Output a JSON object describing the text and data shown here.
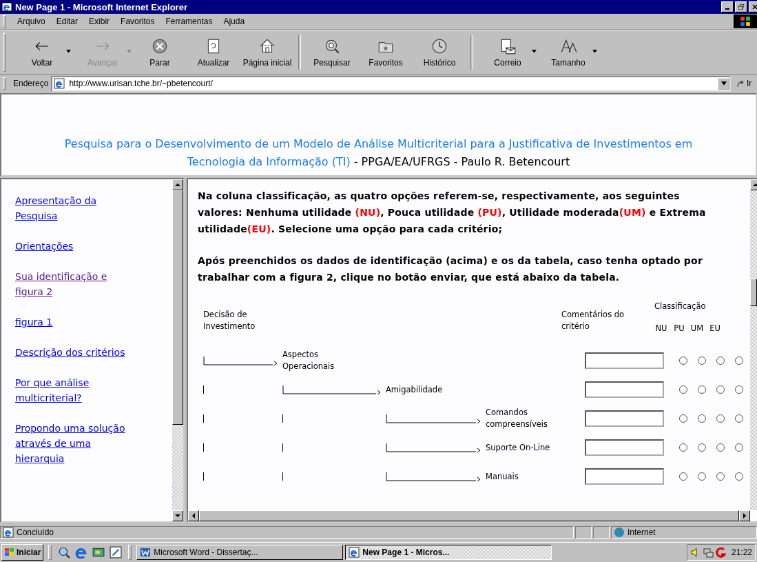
{
  "window": {
    "title": "New Page 1 - Microsoft Internet Explorer"
  },
  "menu": [
    "Arquivo",
    "Editar",
    "Exibir",
    "Favoritos",
    "Ferramentas",
    "Ajuda"
  ],
  "toolbar": [
    {
      "kind": "back",
      "label": "Voltar",
      "disabled": false,
      "dropdown": true
    },
    {
      "kind": "forward",
      "label": "Avançar",
      "disabled": true,
      "dropdown": true
    },
    {
      "kind": "stop",
      "label": "Parar",
      "disabled": false,
      "dropdown": false
    },
    {
      "kind": "refresh",
      "label": "Atualizar",
      "disabled": false,
      "dropdown": false
    },
    {
      "kind": "home",
      "label": "Página inicial",
      "disabled": false,
      "dropdown": false
    },
    {
      "kind": "search",
      "label": "Pesquisar",
      "disabled": false,
      "dropdown": false
    },
    {
      "kind": "favorites",
      "label": "Favoritos",
      "disabled": false,
      "dropdown": false
    },
    {
      "kind": "history",
      "label": "Histórico",
      "disabled": false,
      "dropdown": false
    },
    {
      "kind": "mail",
      "label": "Correio",
      "disabled": false,
      "dropdown": true
    },
    {
      "kind": "font",
      "label": "Tamanho",
      "disabled": false,
      "dropdown": true
    }
  ],
  "address": {
    "label": "Endereço",
    "value": "http://www.urisan.tche.br/~pbetencourt/",
    "go": "Ir"
  },
  "header": [
    {
      "kind": "title",
      "text": "Pesquisa para o Desenvolvimento de um Modelo de Análise Multicriterial para a Justificativa de Investimentos em Tecnologia da Informação (TI)"
    },
    {
      "kind": "plain",
      "text": " - PPGA/EA/UFRGS - Paulo R. Betencourt"
    }
  ],
  "sidebar": {
    "items": [
      {
        "label": "Apresentação da Pesquisa",
        "visited": false
      },
      {
        "label": "Orientações",
        "visited": false
      },
      {
        "label": "Sua identificação e figura 2",
        "visited": true
      },
      {
        "label": "figura 1",
        "visited": false
      },
      {
        "label": "Descrição dos critérios",
        "visited": false
      },
      {
        "label": "Por que análise multicriterial?",
        "visited": false
      },
      {
        "label": "Propondo uma solução através de uma hierarquia",
        "visited": false
      }
    ]
  },
  "content": {
    "paragraphs": [
      [
        {
          "kind": "plain",
          "text": "Na coluna classificação, as quatro opções referem-se, respectivamente, aos seguintes valores: Nenhuma utilidade "
        },
        {
          "kind": "code",
          "text": "(NU)"
        },
        {
          "kind": "plain",
          "text": ", Pouca utilidade "
        },
        {
          "kind": "code",
          "text": "(PU)"
        },
        {
          "kind": "plain",
          "text": ", Utilidade moderada"
        },
        {
          "kind": "code",
          "text": "(UM)"
        },
        {
          "kind": "plain",
          "text": " e Extrema utilidade"
        },
        {
          "kind": "code",
          "text": "(EU)"
        },
        {
          "kind": "plain",
          "text": ". Selecione uma opção para cada critério;"
        }
      ],
      [
        {
          "kind": "plain",
          "text": "Após preenchidos os dados de identificação (acima) e os da tabela, caso tenha optado por trabalhar com a figura 2, clique no botão enviar, que está abaixo da tabela."
        }
      ]
    ],
    "table": {
      "root": "Decisão de Investimento",
      "comment_heading": "Comentários do critério",
      "rating_heading": "Classificação",
      "scale": [
        "NU",
        "PU",
        "UM",
        "EU"
      ],
      "criteria": [
        {
          "label": "Aspectos Operacionais",
          "ratings": [
            {
              "selected": false
            },
            {
              "selected": false
            },
            {
              "selected": false
            },
            {
              "selected": false
            }
          ],
          "children": [
            {
              "label": "Amigabilidade",
              "ratings": [
                {
                  "selected": false
                },
                {
                  "selected": false
                },
                {
                  "selected": false
                },
                {
                  "selected": false
                }
              ],
              "children": [
                {
                  "label": "Comandos compreensíveis",
                  "ratings": [
                    {
                      "selected": false
                    },
                    {
                      "selected": false
                    },
                    {
                      "selected": false
                    },
                    {
                      "selected": false
                    }
                  ]
                },
                {
                  "label": "Suporte On-Line",
                  "ratings": [
                    {
                      "selected": false
                    },
                    {
                      "selected": false
                    },
                    {
                      "selected": false
                    },
                    {
                      "selected": false
                    }
                  ]
                },
                {
                  "label": "Manuais",
                  "ratings": [
                    {
                      "selected": false
                    },
                    {
                      "selected": false
                    },
                    {
                      "selected": false
                    },
                    {
                      "selected": false
                    }
                  ]
                }
              ]
            }
          ]
        }
      ]
    }
  },
  "status_bar": {
    "text": "Concluído",
    "zone": "Internet"
  },
  "taskbar": {
    "start": "Iniciar",
    "tasks": [
      {
        "label": "Microsoft Word - Dissertaç...",
        "kind": "word",
        "selected": false
      },
      {
        "label": "New Page 1 - Micros...",
        "kind": "ie",
        "selected": true
      }
    ],
    "clock": "21:22"
  }
}
